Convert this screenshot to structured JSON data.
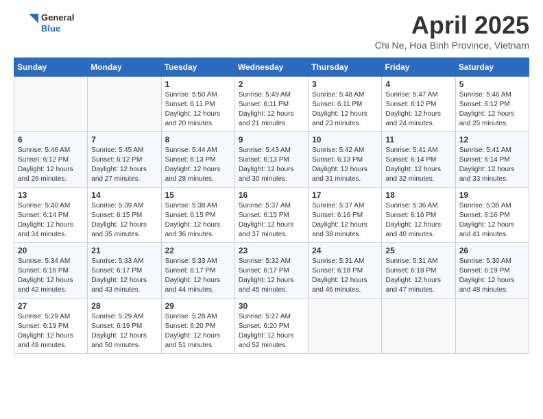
{
  "header": {
    "logo_general": "General",
    "logo_blue": "Blue",
    "month_title": "April 2025",
    "location": "Chi Ne, Hoa Binh Province, Vietnam"
  },
  "days_of_week": [
    "Sunday",
    "Monday",
    "Tuesday",
    "Wednesday",
    "Thursday",
    "Friday",
    "Saturday"
  ],
  "weeks": [
    [
      {
        "day": "",
        "info": ""
      },
      {
        "day": "",
        "info": ""
      },
      {
        "day": "1",
        "sunrise": "5:50 AM",
        "sunset": "6:11 PM",
        "daylight": "12 hours and 20 minutes."
      },
      {
        "day": "2",
        "sunrise": "5:49 AM",
        "sunset": "6:11 PM",
        "daylight": "12 hours and 21 minutes."
      },
      {
        "day": "3",
        "sunrise": "5:48 AM",
        "sunset": "6:11 PM",
        "daylight": "12 hours and 23 minutes."
      },
      {
        "day": "4",
        "sunrise": "5:47 AM",
        "sunset": "6:12 PM",
        "daylight": "12 hours and 24 minutes."
      },
      {
        "day": "5",
        "sunrise": "5:46 AM",
        "sunset": "6:12 PM",
        "daylight": "12 hours and 25 minutes."
      }
    ],
    [
      {
        "day": "6",
        "sunrise": "5:46 AM",
        "sunset": "6:12 PM",
        "daylight": "12 hours and 26 minutes."
      },
      {
        "day": "7",
        "sunrise": "5:45 AM",
        "sunset": "6:12 PM",
        "daylight": "12 hours and 27 minutes."
      },
      {
        "day": "8",
        "sunrise": "5:44 AM",
        "sunset": "6:13 PM",
        "daylight": "12 hours and 28 minutes."
      },
      {
        "day": "9",
        "sunrise": "5:43 AM",
        "sunset": "6:13 PM",
        "daylight": "12 hours and 30 minutes."
      },
      {
        "day": "10",
        "sunrise": "5:42 AM",
        "sunset": "6:13 PM",
        "daylight": "12 hours and 31 minutes."
      },
      {
        "day": "11",
        "sunrise": "5:41 AM",
        "sunset": "6:14 PM",
        "daylight": "12 hours and 32 minutes."
      },
      {
        "day": "12",
        "sunrise": "5:41 AM",
        "sunset": "6:14 PM",
        "daylight": "12 hours and 33 minutes."
      }
    ],
    [
      {
        "day": "13",
        "sunrise": "5:40 AM",
        "sunset": "6:14 PM",
        "daylight": "12 hours and 34 minutes."
      },
      {
        "day": "14",
        "sunrise": "5:39 AM",
        "sunset": "6:15 PM",
        "daylight": "12 hours and 35 minutes."
      },
      {
        "day": "15",
        "sunrise": "5:38 AM",
        "sunset": "6:15 PM",
        "daylight": "12 hours and 36 minutes."
      },
      {
        "day": "16",
        "sunrise": "5:37 AM",
        "sunset": "6:15 PM",
        "daylight": "12 hours and 37 minutes."
      },
      {
        "day": "17",
        "sunrise": "5:37 AM",
        "sunset": "6:16 PM",
        "daylight": "12 hours and 38 minutes."
      },
      {
        "day": "18",
        "sunrise": "5:36 AM",
        "sunset": "6:16 PM",
        "daylight": "12 hours and 40 minutes."
      },
      {
        "day": "19",
        "sunrise": "5:35 AM",
        "sunset": "6:16 PM",
        "daylight": "12 hours and 41 minutes."
      }
    ],
    [
      {
        "day": "20",
        "sunrise": "5:34 AM",
        "sunset": "6:16 PM",
        "daylight": "12 hours and 42 minutes."
      },
      {
        "day": "21",
        "sunrise": "5:33 AM",
        "sunset": "6:17 PM",
        "daylight": "12 hours and 43 minutes."
      },
      {
        "day": "22",
        "sunrise": "5:33 AM",
        "sunset": "6:17 PM",
        "daylight": "12 hours and 44 minutes."
      },
      {
        "day": "23",
        "sunrise": "5:32 AM",
        "sunset": "6:17 PM",
        "daylight": "12 hours and 45 minutes."
      },
      {
        "day": "24",
        "sunrise": "5:31 AM",
        "sunset": "6:18 PM",
        "daylight": "12 hours and 46 minutes."
      },
      {
        "day": "25",
        "sunrise": "5:31 AM",
        "sunset": "6:18 PM",
        "daylight": "12 hours and 47 minutes."
      },
      {
        "day": "26",
        "sunrise": "5:30 AM",
        "sunset": "6:19 PM",
        "daylight": "12 hours and 48 minutes."
      }
    ],
    [
      {
        "day": "27",
        "sunrise": "5:29 AM",
        "sunset": "6:19 PM",
        "daylight": "12 hours and 49 minutes."
      },
      {
        "day": "28",
        "sunrise": "5:29 AM",
        "sunset": "6:19 PM",
        "daylight": "12 hours and 50 minutes."
      },
      {
        "day": "29",
        "sunrise": "5:28 AM",
        "sunset": "6:20 PM",
        "daylight": "12 hours and 51 minutes."
      },
      {
        "day": "30",
        "sunrise": "5:27 AM",
        "sunset": "6:20 PM",
        "daylight": "12 hours and 52 minutes."
      },
      {
        "day": "",
        "info": ""
      },
      {
        "day": "",
        "info": ""
      },
      {
        "day": "",
        "info": ""
      }
    ]
  ],
  "labels": {
    "sunrise": "Sunrise:",
    "sunset": "Sunset:",
    "daylight": "Daylight:"
  }
}
